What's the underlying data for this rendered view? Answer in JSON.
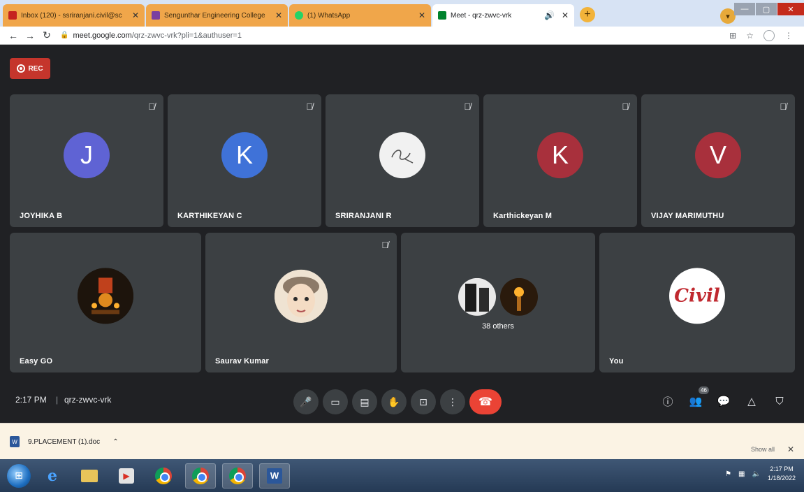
{
  "browser": {
    "tabs": [
      {
        "title": "Inbox (120) - ssriranjani.civil@sc",
        "favicon_color": "#c5221f",
        "active": false
      },
      {
        "title": "Sengunthar Engineering College",
        "favicon_color": "#7b3fa0",
        "active": false
      },
      {
        "title": "(1) WhatsApp",
        "favicon_color": "#25d366",
        "active": false
      },
      {
        "title": "Meet - qrz-zwvc-vrk",
        "favicon_color": "#00832d",
        "active": true
      }
    ],
    "new_tab_icon": "+",
    "close_icon": "✕",
    "address": {
      "host": "meet.google.com",
      "path": "/qrz-zwvc-vrk?pli=1&authuser=1"
    }
  },
  "meet": {
    "rec_label": "REC",
    "participants_row1": [
      {
        "name": "JOYHIKA B",
        "initial": "J",
        "color": "#5f63d4"
      },
      {
        "name": "KARTHIKEYAN C",
        "initial": "K",
        "color": "#3f72d8"
      },
      {
        "name": "SRIRANJANI R",
        "initial": "",
        "color": "#f1f1f1"
      },
      {
        "name": "Karthickeyan M",
        "initial": "K",
        "color": "#a8303c"
      },
      {
        "name": "VIJAY MARIMUTHU",
        "initial": "V",
        "color": "#a8303c"
      }
    ],
    "participants_row2": [
      {
        "name": "Easy GO"
      },
      {
        "name": "Saurav Kumar"
      },
      {
        "name": "38 others"
      },
      {
        "name": "You",
        "avatar_text": "Civil"
      }
    ],
    "clock": "2:17 PM",
    "meeting_code": "qrz-zwvc-vrk",
    "people_count": "46",
    "end_call_color": "#ea4335"
  },
  "downloads": {
    "file": "9.PLACEMENT (1).doc",
    "show_all": "Show all"
  },
  "taskbar": {
    "time": "2:17 PM",
    "date": "1/18/2022"
  }
}
